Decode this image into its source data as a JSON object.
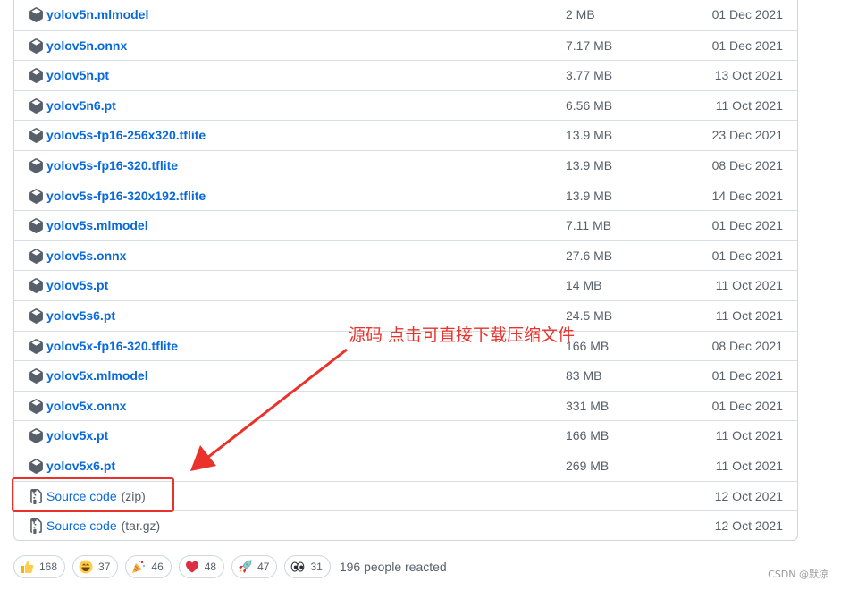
{
  "assets": [
    {
      "name": "yolov5n.mlmodel",
      "size": "2 MB",
      "date": "01 Dec 2021"
    },
    {
      "name": "yolov5n.onnx",
      "size": "7.17 MB",
      "date": "01 Dec 2021"
    },
    {
      "name": "yolov5n.pt",
      "size": "3.77 MB",
      "date": "13 Oct 2021"
    },
    {
      "name": "yolov5n6.pt",
      "size": "6.56 MB",
      "date": "11 Oct 2021"
    },
    {
      "name": "yolov5s-fp16-256x320.tflite",
      "size": "13.9 MB",
      "date": "23 Dec 2021"
    },
    {
      "name": "yolov5s-fp16-320.tflite",
      "size": "13.9 MB",
      "date": "08 Dec 2021"
    },
    {
      "name": "yolov5s-fp16-320x192.tflite",
      "size": "13.9 MB",
      "date": "14 Dec 2021"
    },
    {
      "name": "yolov5s.mlmodel",
      "size": "7.11 MB",
      "date": "01 Dec 2021"
    },
    {
      "name": "yolov5s.onnx",
      "size": "27.6 MB",
      "date": "01 Dec 2021"
    },
    {
      "name": "yolov5s.pt",
      "size": "14 MB",
      "date": "11 Oct 2021"
    },
    {
      "name": "yolov5s6.pt",
      "size": "24.5 MB",
      "date": "11 Oct 2021"
    },
    {
      "name": "yolov5x-fp16-320.tflite",
      "size": "166 MB",
      "date": "08 Dec 2021"
    },
    {
      "name": "yolov5x.mlmodel",
      "size": "83 MB",
      "date": "01 Dec 2021"
    },
    {
      "name": "yolov5x.onnx",
      "size": "331 MB",
      "date": "01 Dec 2021"
    },
    {
      "name": "yolov5x.pt",
      "size": "166 MB",
      "date": "11 Oct 2021"
    },
    {
      "name": "yolov5x6.pt",
      "size": "269 MB",
      "date": "11 Oct 2021"
    }
  ],
  "source_assets": [
    {
      "label": "Source code",
      "ext": "(zip)",
      "date": "12 Oct 2021"
    },
    {
      "label": "Source code",
      "ext": "(tar.gz)",
      "date": "12 Oct 2021"
    }
  ],
  "annotation": {
    "text": "源码 点击可直接下载压缩文件",
    "color": "#e8322b"
  },
  "reactions": [
    {
      "emoji": "thumbs-up",
      "count": "168"
    },
    {
      "emoji": "laugh",
      "count": "37"
    },
    {
      "emoji": "hooray",
      "count": "46"
    },
    {
      "emoji": "heart",
      "count": "48"
    },
    {
      "emoji": "rocket",
      "count": "47"
    },
    {
      "emoji": "eyes",
      "count": "31"
    }
  ],
  "reactions_summary": "196 people reacted",
  "watermark": "CSDN @默凉",
  "colors": {
    "link": "#0969da",
    "muted": "#57606a",
    "border": "#d0d7de"
  }
}
